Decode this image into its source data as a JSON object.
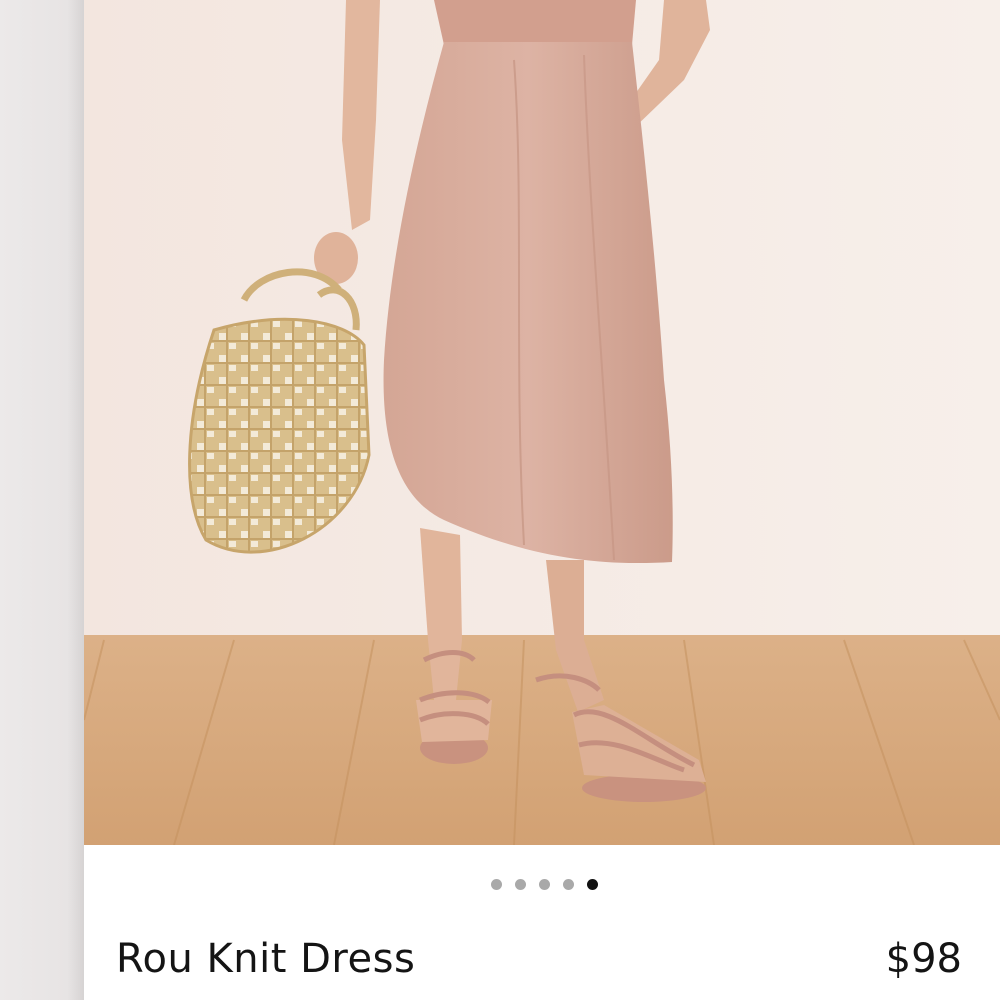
{
  "product": {
    "name": "Rou Knit Dress",
    "price": "$98"
  },
  "carousel": {
    "image_count": 5,
    "active_index": 4
  },
  "colors": {
    "dress": "#d7aa9a",
    "wall": "#f4e9e3",
    "floor": "#d9ad80",
    "text": "#141414",
    "dot_inactive": "#a9a9a9",
    "dot_active": "#111111"
  }
}
